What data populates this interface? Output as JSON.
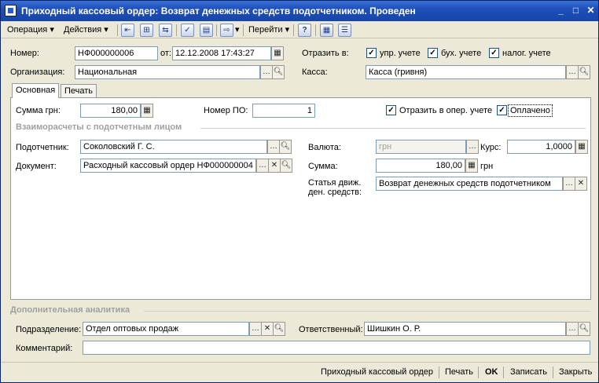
{
  "window": {
    "title": "Приходный кассовый ордер: Возврат денежных средств подотчетником. Проведен"
  },
  "toolbar": {
    "operation": "Операция",
    "actions": "Действия",
    "goto": "Перейти",
    "help": "?"
  },
  "header": {
    "number_label": "Номер:",
    "number": "НФ000000006",
    "from_label": "от:",
    "date": "12.12.2008 17:43:27",
    "reflect_label": "Отразить в:",
    "mgmt_label": "упр. учете",
    "acc_label": "бух. учете",
    "tax_label": "налог. учете",
    "org_label": "Организация:",
    "org": "Национальная",
    "cash_label": "Касса:",
    "cash": "Касса (гривня)"
  },
  "tabs": {
    "main": "Основная",
    "print": "Печать"
  },
  "main": {
    "sum_label": "Сумма грн:",
    "sum": "180,00",
    "po_label": "Номер ПО:",
    "po": "1",
    "oper_label": "Отразить в опер. учете",
    "paid_label": "Оплачено",
    "settlements_title": "Взаиморасчеты с подотчетным лицом",
    "person_label": "Подотчетник:",
    "person": "Соколовский Г. С.",
    "doc_label": "Документ:",
    "doc": "Расходный кассовый ордер НФ000000004",
    "currency_label": "Валюта:",
    "currency": "грн",
    "rate_label": "Курс:",
    "rate": "1,0000",
    "amount_label": "Сумма:",
    "amount": "180,00",
    "amount_unit": "грн",
    "flow_label_1": "Статья движ.",
    "flow_label_2": "ден. средств:",
    "flow": "Возврат денежных средств подотчетником"
  },
  "extra": {
    "title": "Дополнительная аналитика",
    "dept_label": "Подразделение:",
    "dept": "Отдел оптовых продаж",
    "resp_label": "Ответственный:",
    "resp": "Шишкин О. Р.",
    "comment_label": "Комментарий:",
    "comment": ""
  },
  "status": {
    "print_form": "Приходный кассовый ордер",
    "print": "Печать",
    "ok": "OK",
    "save": "Записать",
    "close": "Закрыть"
  }
}
